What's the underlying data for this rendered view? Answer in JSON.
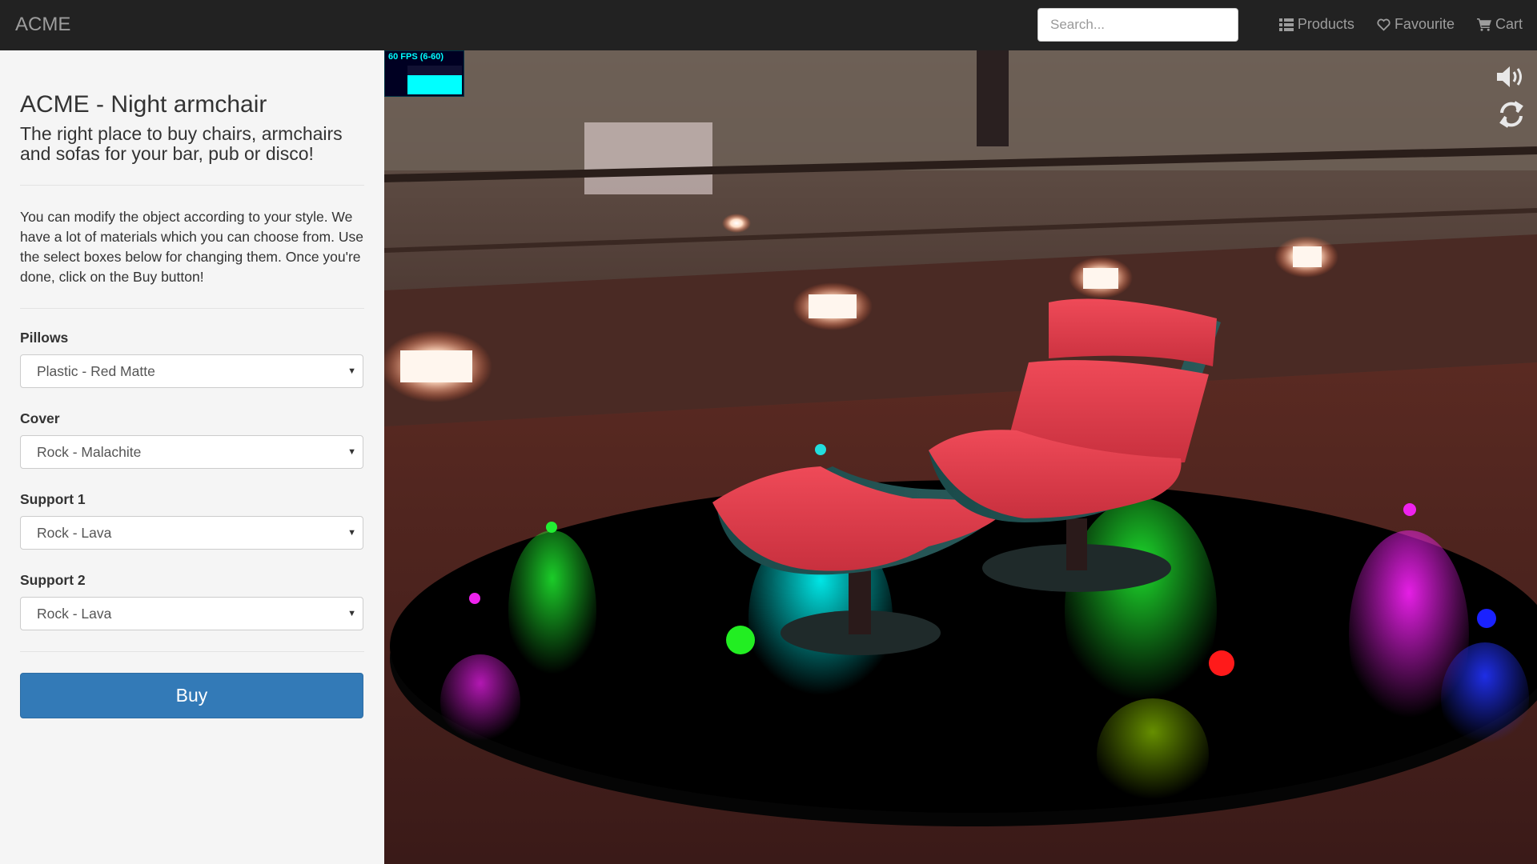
{
  "navbar": {
    "brand": "ACME",
    "search_placeholder": "Search...",
    "links": [
      {
        "label": "Products",
        "icon": "list-icon"
      },
      {
        "label": "Favourite",
        "icon": "heart-icon"
      },
      {
        "label": "Cart",
        "icon": "cart-icon"
      }
    ]
  },
  "sidebar": {
    "title": "ACME - Night armchair",
    "subtitle": "The right place to buy chairs, armchairs and sofas for your bar, pub or disco!",
    "description": "You can modify the object according to your style. We have a lot of materials which you can choose from. Use the select boxes below for changing them. Once you're done, click on the Buy button!",
    "fields": [
      {
        "label": "Pillows",
        "value": "Plastic - Red Matte"
      },
      {
        "label": "Cover",
        "value": "Rock - Malachite"
      },
      {
        "label": "Support 1",
        "value": "Rock - Lava"
      },
      {
        "label": "Support 2",
        "value": "Rock - Lava"
      }
    ],
    "buy_label": "Buy"
  },
  "viewport": {
    "fps_text": "60 FPS (6-60)",
    "icons": [
      "speaker-icon",
      "refresh-icon"
    ],
    "colors": {
      "platform": "#000000",
      "chair": "#e8414f",
      "cyan": "#00e5ee",
      "green": "#11ee22",
      "magenta": "#ee11ee",
      "blue": "#1a22ff",
      "red": "#ff1a1a"
    }
  }
}
